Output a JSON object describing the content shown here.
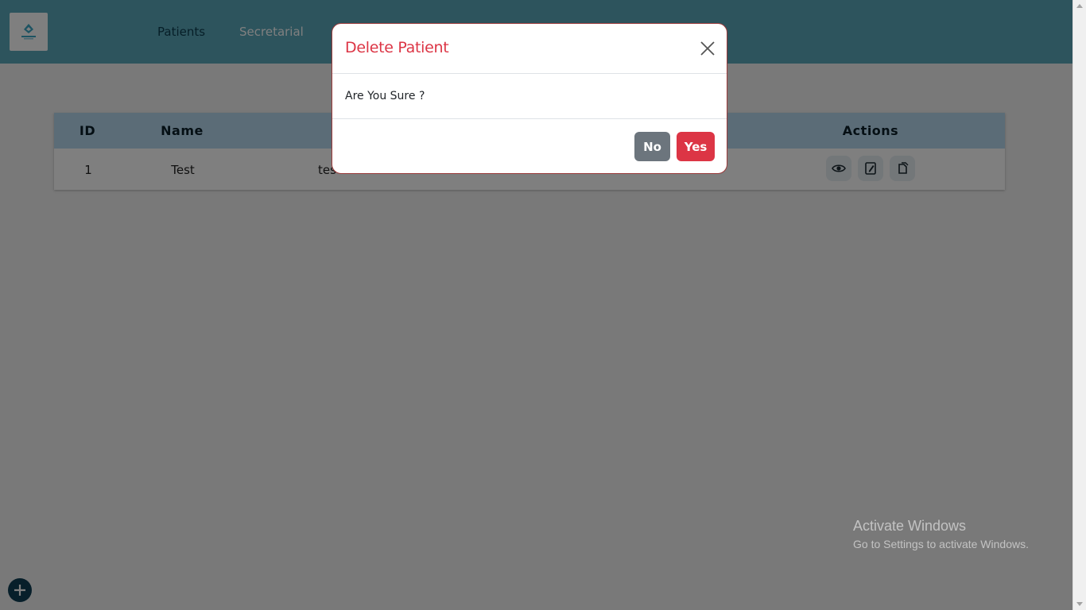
{
  "app": {
    "logo_icon": "clinic-logo-icon",
    "nav": [
      {
        "label": "Patients",
        "active": true
      },
      {
        "label": "Secretarial",
        "active": false
      }
    ]
  },
  "table": {
    "headers": {
      "id": "ID",
      "name": "Name",
      "actions": "Actions"
    },
    "rows": [
      {
        "id": "1",
        "name": "Test",
        "email": "tes"
      }
    ],
    "row_action_icons": [
      "eye-icon",
      "edit-icon",
      "delete-icon"
    ]
  },
  "modal": {
    "title": "Delete Patient",
    "message": "Are You Sure ?",
    "no_label": "No",
    "yes_label": "Yes",
    "close_icon": "close-icon"
  },
  "fab_icon": "plus-icon",
  "watermark": {
    "title": "Activate Windows",
    "subtitle": "Go to Settings to activate Windows."
  },
  "colors": {
    "header": "#5ba9bb",
    "table_header": "#b7d9ee",
    "danger": "#dc3545",
    "secondary": "#6c757d",
    "fab": "#0f3e54"
  }
}
